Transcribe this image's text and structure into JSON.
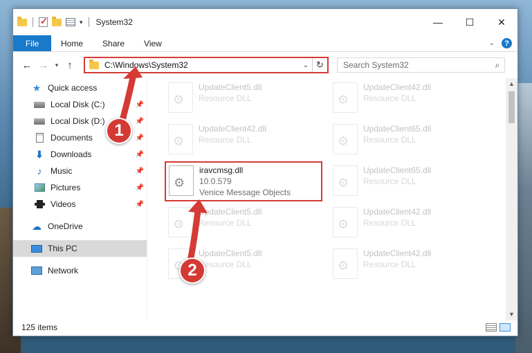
{
  "window": {
    "title": "System32",
    "controls": {
      "minimize": "—",
      "maximize": "☐",
      "close": "✕"
    }
  },
  "ribbon": {
    "file": "File",
    "tabs": [
      "Home",
      "Share",
      "View"
    ],
    "help": "?"
  },
  "address": {
    "path": "C:\\Windows\\System32",
    "search_placeholder": "Search System32"
  },
  "sidebar": {
    "items": [
      {
        "label": "Quick access",
        "icon": "star-icon"
      },
      {
        "label": "Local Disk (C:)",
        "icon": "disk-icon",
        "pinned": true
      },
      {
        "label": "Local Disk (D:)",
        "icon": "disk-icon",
        "pinned": true
      },
      {
        "label": "Documents",
        "icon": "documents-icon",
        "pinned": true
      },
      {
        "label": "Downloads",
        "icon": "downloads-icon",
        "pinned": true
      },
      {
        "label": "Music",
        "icon": "music-icon",
        "pinned": true
      },
      {
        "label": "Pictures",
        "icon": "pictures-icon",
        "pinned": true
      },
      {
        "label": "Videos",
        "icon": "videos-icon",
        "pinned": true
      },
      {
        "label": "OneDrive",
        "icon": "onedrive-icon"
      },
      {
        "label": "This PC",
        "icon": "this-pc-icon",
        "selected": true
      },
      {
        "label": "Network",
        "icon": "network-icon"
      }
    ]
  },
  "files": [
    {
      "name": "UpdateClient5.dll",
      "type": "Resource DLL"
    },
    {
      "name": "UpdateClient42.dll",
      "type": "Resource DLL"
    },
    {
      "name": "UpdateClient42.dll",
      "type": "Resource DLL"
    },
    {
      "name": "UpdateClient65.dll",
      "type": "Resource DLL"
    },
    {
      "name": "iravcmsg.dll",
      "version": "10.0.579",
      "description": "Venice Message Objects"
    },
    {
      "name": "UpdateClient65.dll",
      "type": "Resource DLL"
    },
    {
      "name": "UpdateClient5.dll",
      "type": "Resource DLL"
    },
    {
      "name": "UpdateClient42.dll",
      "type": "Resource DLL"
    },
    {
      "name": "UpdateClient5.dll",
      "type": "Resource DLL"
    },
    {
      "name": "UpdateClient42.dll",
      "type": "Resource DLL"
    }
  ],
  "status": {
    "item_count": "125 items"
  },
  "callouts": {
    "step1": "1",
    "step2": "2"
  },
  "colors": {
    "accent": "#1979ca",
    "highlight": "#d63a35",
    "selected": "#cce8ff"
  }
}
